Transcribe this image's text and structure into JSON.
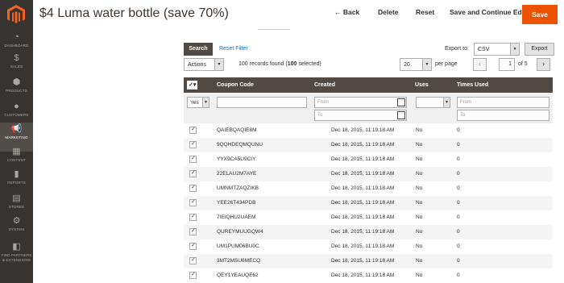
{
  "title": "$4 Luma water bottle (save 70%)",
  "header": {
    "back": "← Back",
    "delete": "Delete",
    "reset": "Reset",
    "save_continue": "Save and Continue Edit",
    "save": "Save"
  },
  "nav": [
    {
      "label": "DASHBOARD",
      "icon": "dashboard-icon",
      "glyph": "◔"
    },
    {
      "label": "SALES",
      "icon": "dollar-icon",
      "glyph": "$"
    },
    {
      "label": "PRODUCTS",
      "icon": "box-icon",
      "glyph": "⬢"
    },
    {
      "label": "CUSTOMERS",
      "icon": "person-icon",
      "glyph": "●"
    },
    {
      "label": "MARKETING",
      "icon": "megaphone-icon",
      "glyph": "📢"
    },
    {
      "label": "CONTENT",
      "icon": "layout-icon",
      "glyph": "▦"
    },
    {
      "label": "REPORTS",
      "icon": "bars-icon",
      "glyph": "▮"
    },
    {
      "label": "STORES",
      "icon": "store-icon",
      "glyph": "▤"
    },
    {
      "label": "SYSTEM",
      "icon": "gear-icon",
      "glyph": "⚙"
    },
    {
      "label": "FIND PARTNERS & EXTENSIONS",
      "icon": "blocks-icon",
      "glyph": "◧"
    }
  ],
  "toolbar": {
    "search": "Search",
    "reset_filter": "Reset Filter",
    "export_label": "Export to:",
    "export_value": "CSV",
    "export_button": "Export",
    "actions": "Actions",
    "records_prefix": "100 records found (",
    "records_selected": "100",
    "records_suffix": " selected)",
    "per_page_value": "20",
    "per_page_label": "per page",
    "page": "1",
    "of_pages": "of 5"
  },
  "columns": {
    "code": "Coupon Code",
    "created": "Created",
    "uses": "Uses",
    "times_used": "Times Used"
  },
  "filters": {
    "select_value": "Yes",
    "from": "From",
    "to": "To",
    "uses_value": ""
  },
  "rows": [
    {
      "code": "QAIEBQAQIE8M",
      "created": "Dec 18, 2015, 11:19:18 AM",
      "uses": "No",
      "times": "0"
    },
    {
      "code": "9QQHDEQMQUNU",
      "created": "Dec 18, 2015, 11:19:18 AM",
      "uses": "No",
      "times": "0"
    },
    {
      "code": "YYX9CA5U9CIY",
      "created": "Dec 18, 2015, 11:19:18 AM",
      "uses": "No",
      "times": "0"
    },
    {
      "code": "22ELAU2M7AYE",
      "created": "Dec 18, 2015, 11:19:18 AM",
      "uses": "No",
      "times": "0"
    },
    {
      "code": "UMNMTZAQZIKB",
      "created": "Dec 18, 2015, 11:19:18 AM",
      "uses": "No",
      "times": "0"
    },
    {
      "code": "YEE26T434PDB",
      "created": "Dec 18, 2015, 11:19:18 AM",
      "uses": "No",
      "times": "0"
    },
    {
      "code": "7IEIQHU2UAEM",
      "created": "Dec 18, 2015, 11:19:18 AM",
      "uses": "No",
      "times": "0"
    },
    {
      "code": "QUREYMUUGQW4",
      "created": "Dec 18, 2015, 11:19:18 AM",
      "uses": "No",
      "times": "0"
    },
    {
      "code": "UM1PUM06BU0C",
      "created": "Dec 18, 2015, 11:19:18 AM",
      "uses": "No",
      "times": "0"
    },
    {
      "code": "3MT2MSU6MECQ",
      "created": "Dec 18, 2015, 11:19:18 AM",
      "uses": "No",
      "times": "0"
    },
    {
      "code": "QEY1YEAUQE62",
      "created": "Dec 18, 2015, 11:19:18 AM",
      "uses": "No",
      "times": "0"
    }
  ],
  "colors": {
    "accent": "#eb5202",
    "sidebar": "#373330",
    "header_dark": "#514943",
    "link": "#007bdb"
  }
}
